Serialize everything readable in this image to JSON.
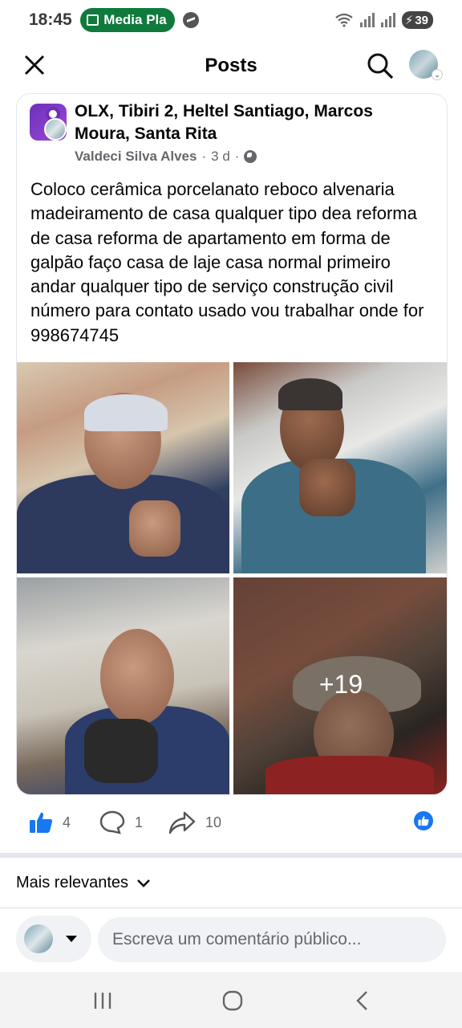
{
  "status_bar": {
    "time": "18:45",
    "media_pill": "Media Pla",
    "battery": "39"
  },
  "header": {
    "title": "Posts"
  },
  "post": {
    "group_name": "OLX, Tibiri 2, Heltel Santiago, Marcos Moura, Santa Rita",
    "author": "Valdeci Silva Alves",
    "time_ago": "3 d",
    "separator": "·",
    "text": "Coloco cerâmica porcelanato reboco alvenaria madeiramento de casa qualquer tipo dea reforma de casa reforma de apartamento em forma de galpão faço casa de laje casa normal primeiro andar qualquer tipo de serviço construção civil número para contato usado vou trabalhar onde for 998674745",
    "more_photos": "+19"
  },
  "reactions": {
    "likes": "4",
    "comments": "1",
    "shares": "10"
  },
  "comments": {
    "sort_label": "Mais relevantes",
    "placeholder": "Escreva um comentário público..."
  },
  "colors": {
    "accent": "#1877f2",
    "media_pill": "#0e7a3c",
    "secondary_text": "#65676b"
  }
}
